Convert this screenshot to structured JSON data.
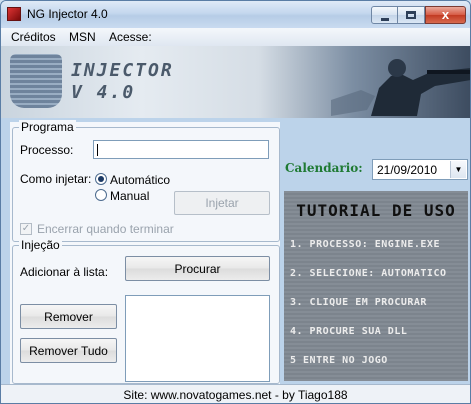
{
  "window": {
    "title": "NG Injector 4.0",
    "close_glyph": "x"
  },
  "menu": [
    "Créditos",
    "MSN",
    "Acesse:"
  ],
  "banner": {
    "title": "INJECTOR",
    "version": "V 4.0"
  },
  "programa": {
    "legend": "Programa",
    "process_label": "Processo:",
    "process_value": "",
    "inject_label": "Como injetar:",
    "options": [
      "Automático",
      "Manual"
    ],
    "selected": "Automático",
    "inject_button": "Injetar",
    "close_checkbox_label": "Encerrar quando terminar",
    "close_checkbox_checked": true,
    "check_glyph": "✓"
  },
  "injecao": {
    "legend": "Injeção",
    "add_label": "Adicionar à lista:",
    "browse_button": "Procurar",
    "remove_button": "Remover",
    "remove_all_button": "Remover Tudo",
    "dll_list": []
  },
  "calendar": {
    "label": "Calendario:",
    "value": "21/09/2010",
    "drop_glyph": "▼"
  },
  "tutorial": {
    "title": "TUTORIAL DE USO",
    "steps": [
      "1. PROCESSO: ENGINE.EXE",
      "2. SELECIONE: AUTOMATICO",
      "3. CLIQUE EM PROCURAR",
      "4. PROCURE SUA DLL",
      "5 ENTRE NO JOGO"
    ]
  },
  "status": {
    "text": "Site: www.novatogames.net - by Tiago188"
  },
  "colors": {
    "calendar_label": "#1f7a33",
    "close_button": "#c13a22"
  }
}
